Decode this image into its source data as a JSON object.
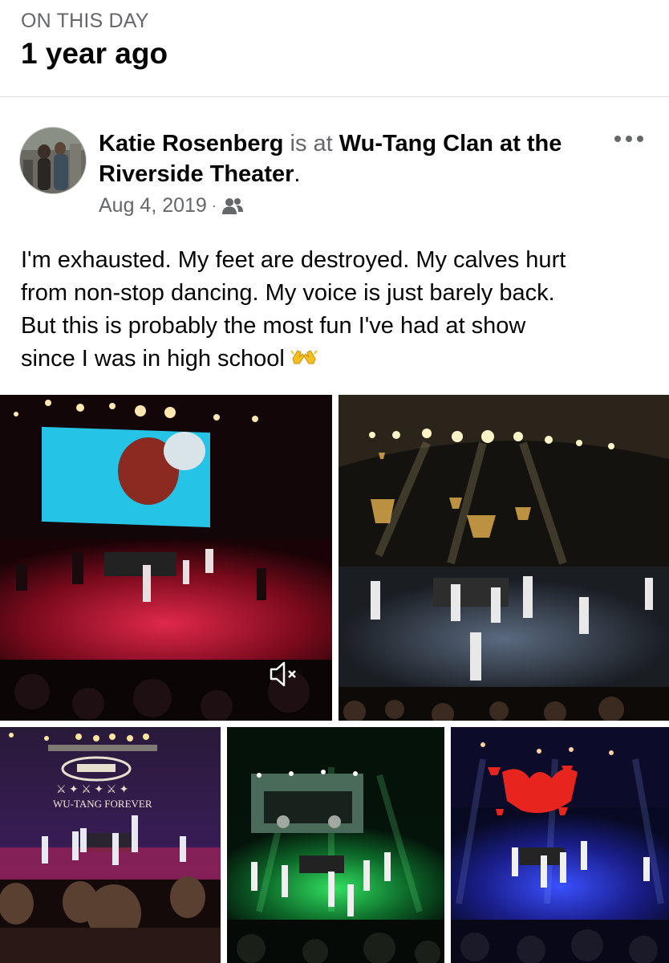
{
  "header": {
    "kicker": "ON THIS DAY",
    "title": "1 year ago"
  },
  "post": {
    "author": "Katie Rosenberg",
    "connector": "is at",
    "place": "Wu-Tang Clan at the Riverside Theater",
    "place_suffix": ".",
    "date": "Aug 4, 2019",
    "separator": "·",
    "audience_icon": "friends-icon",
    "more_icon": "more-options-icon",
    "text_lines": [
      "I'm exhausted. My feet are destroyed. My calves hurt",
      "from non-stop dancing. My voice is just barely back.",
      "But this is probably the most fun I've had at show",
      "since I was in high school"
    ],
    "text_emoji": "raising-hands-emoji"
  },
  "photos": [
    {
      "name": "concert-video",
      "icon": "muted-speaker-icon"
    },
    {
      "name": "concert-photo-stage-lights"
    },
    {
      "name": "concert-photo-wu-tang-forever",
      "screen_text": "WU-TANG FOREVER"
    },
    {
      "name": "concert-photo-green"
    },
    {
      "name": "concert-photo-blue-logo"
    }
  ],
  "colors": {
    "text_primary": "#050505",
    "text_secondary": "#65676b",
    "divider": "#dadde1"
  }
}
